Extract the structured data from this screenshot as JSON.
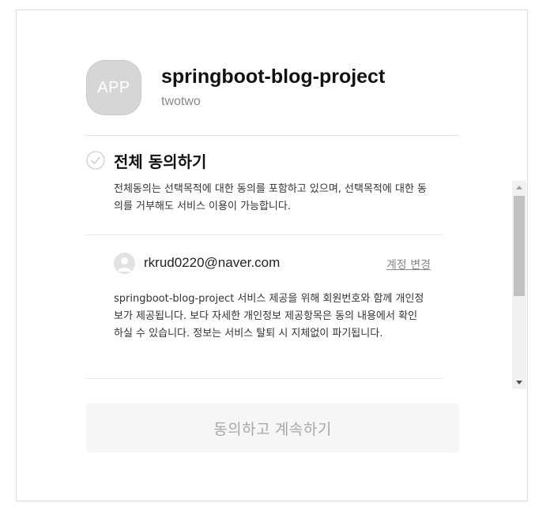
{
  "app": {
    "icon_text": "APP",
    "name": "springboot-blog-project",
    "developer": "twotwo"
  },
  "agree_all": {
    "title": "전체 동의하기",
    "description": "전체동의는 선택목적에 대한 동의를 포함하고 있으며, 선택목적에 대한 동의를 거부해도 서비스 이용이 가능합니다."
  },
  "account": {
    "email": "rkrud0220@naver.com",
    "change_label": "계정 변경",
    "avatar_icon": "user-avatar-icon"
  },
  "consent": {
    "text": "springboot-blog-project 서비스 제공을 위해 회원번호와 함께 개인정보가 제공됩니다. 보다 자세한 개인정보 제공항목은 동의 내용에서 확인하실 수 있습니다. 정보는 서비스 탈퇴 시 지체없이 파기됩니다."
  },
  "actions": {
    "continue_label": "동의하고 계속하기"
  },
  "colors": {
    "button_bg": "#f6f6f6",
    "button_text": "#a7a7a7",
    "icon_bg": "#d6d6d6"
  }
}
